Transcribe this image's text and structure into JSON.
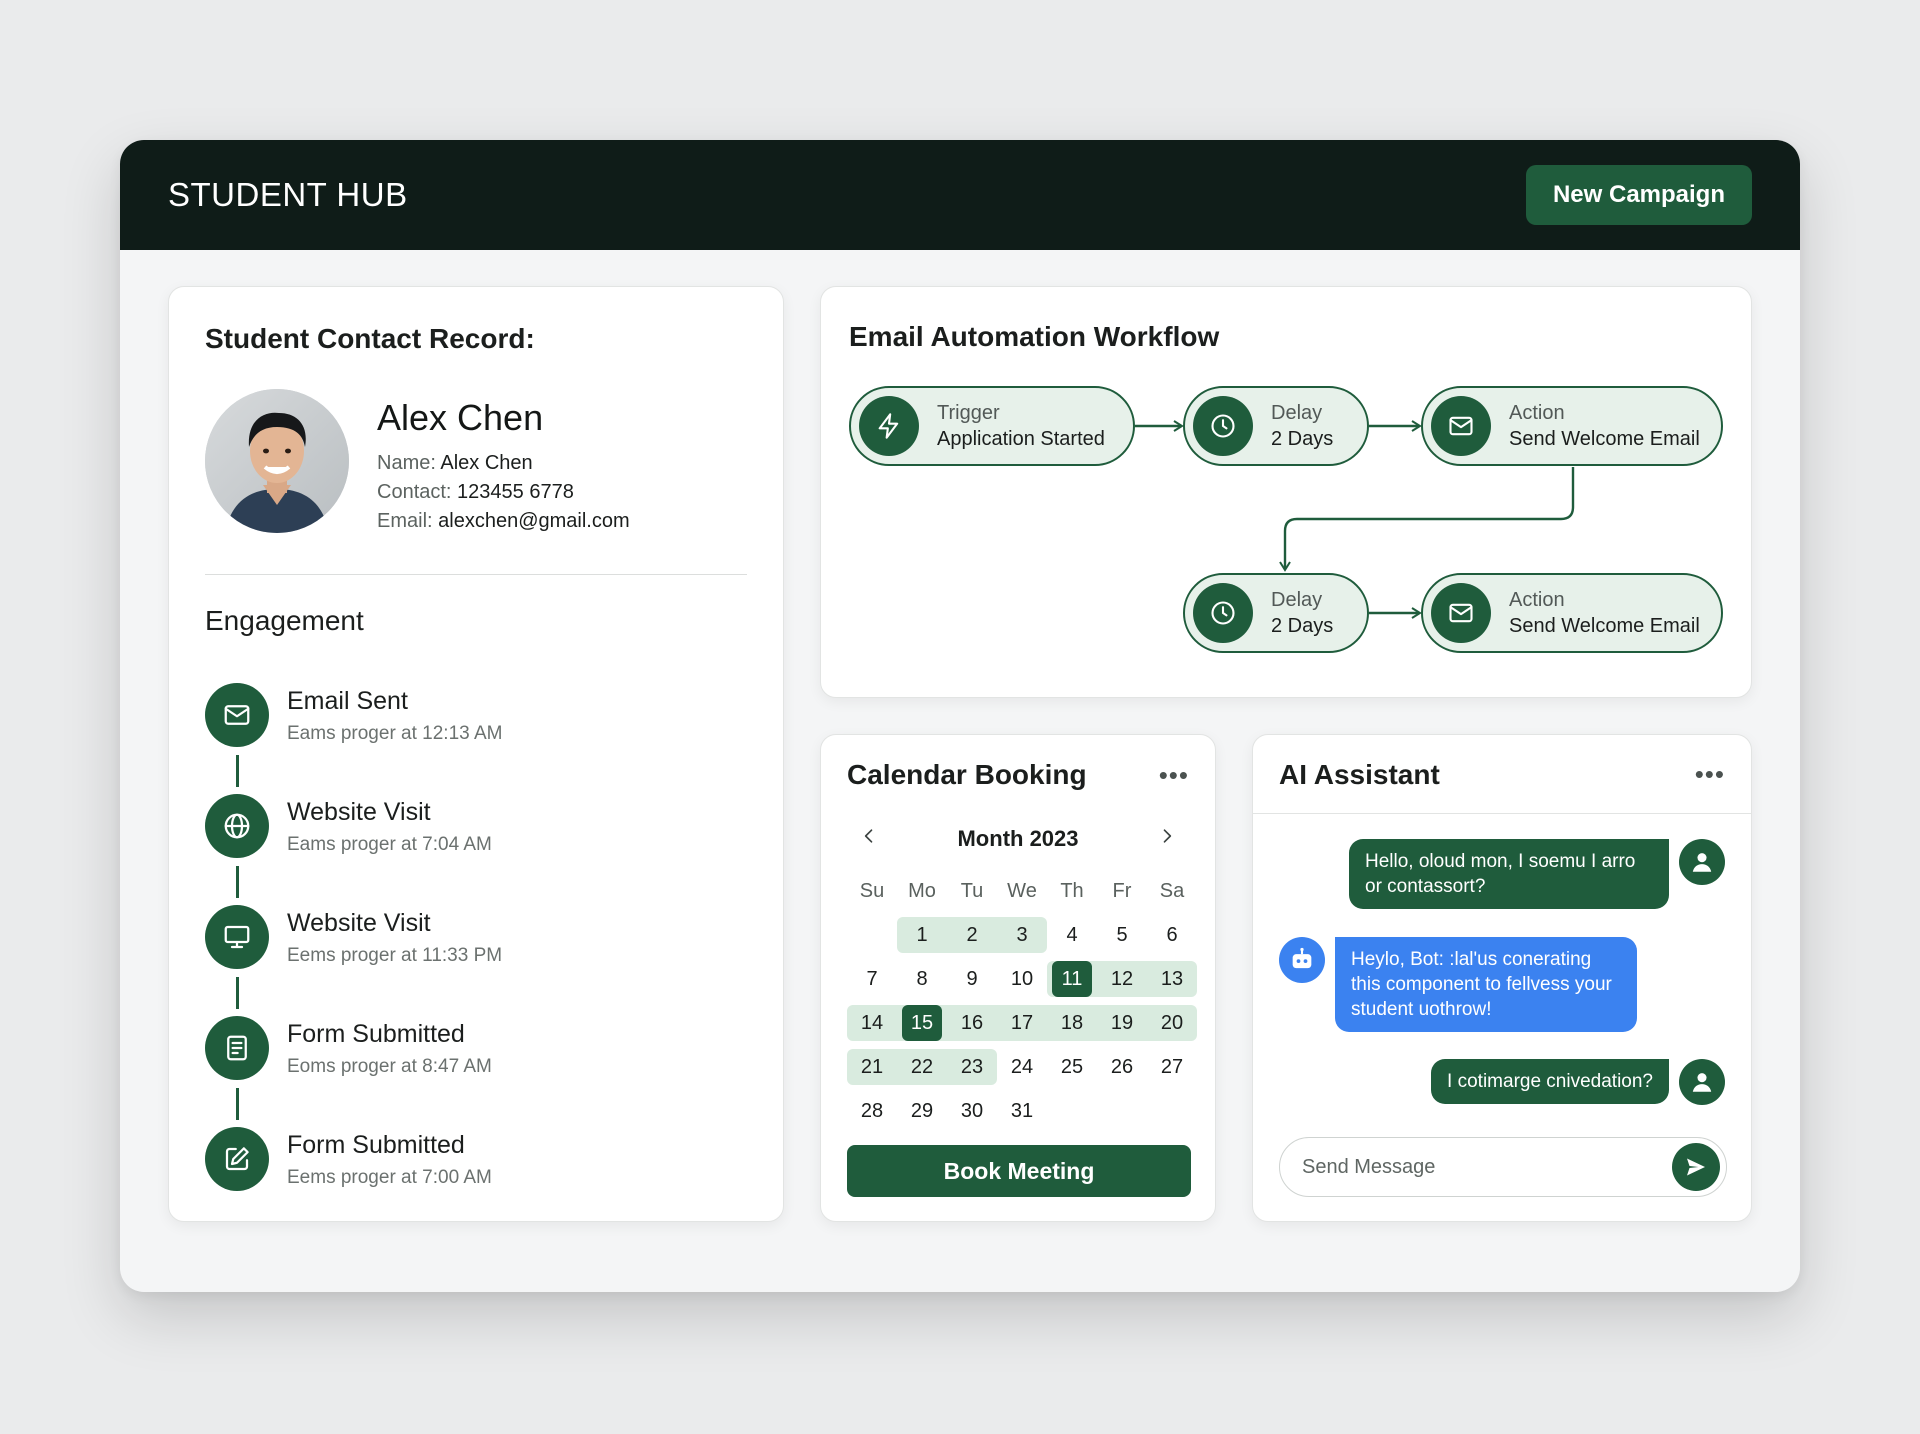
{
  "app": {
    "brand": "STUDENT HUB",
    "new_campaign_label": "New Campaign"
  },
  "contact": {
    "title": "Student Contact Record:",
    "name": "Alex Chen",
    "fields": [
      {
        "label": "Name:",
        "value": "Alex Chen"
      },
      {
        "label": "Contact:",
        "value": "123455 6778"
      },
      {
        "label": "Email:",
        "value": "alexchen@gmail.com"
      }
    ],
    "engagement_title": "Engagement",
    "engagement": [
      {
        "icon": "mail-icon",
        "title": "Email Sent",
        "sub": "Eams proger at 12:13 AM"
      },
      {
        "icon": "globe-icon",
        "title": "Website Visit",
        "sub": "Eams proger at 7:04 AM"
      },
      {
        "icon": "monitor-icon",
        "title": "Website Visit",
        "sub": "Eems proger at 11:33 PM"
      },
      {
        "icon": "document-icon",
        "title": "Form Submitted",
        "sub": "Eoms proger at 8:47 AM"
      },
      {
        "icon": "edit-icon",
        "title": "Form Submitted",
        "sub": "Eems proger at 7:00 AM"
      }
    ]
  },
  "workflow": {
    "title": "Email Automation Workflow",
    "nodes": [
      {
        "icon": "lightning-icon",
        "kind": "Trigger",
        "label": "Application Started"
      },
      {
        "icon": "clock-icon",
        "kind": "Delay",
        "label": "2 Days"
      },
      {
        "icon": "mail-icon",
        "kind": "Action",
        "label": "Send Welcome Email"
      },
      {
        "icon": "clock-icon",
        "kind": "Delay",
        "label": "2 Days"
      },
      {
        "icon": "mail-icon",
        "kind": "Action",
        "label": "Send Welcome Email"
      }
    ]
  },
  "calendar": {
    "title": "Calendar Booking",
    "more_label": "•••",
    "month_label": "Month 2023",
    "weekdays": [
      "Su",
      "Mo",
      "Tu",
      "We",
      "Th",
      "Fr",
      "Sa"
    ],
    "first_weekday_offset": 1,
    "days_in_month": 31,
    "selected_days": [
      11,
      15
    ],
    "highlighted_days": [
      1,
      2,
      3,
      12,
      13,
      14,
      16,
      17,
      18,
      19,
      20,
      21,
      22,
      23
    ],
    "book_label": "Book Meeting"
  },
  "assistant": {
    "title": "AI Assistant",
    "more_label": "•••",
    "messages": [
      {
        "from": "user",
        "text": "Hello, oloud mon, I soemu I arro or contassort?"
      },
      {
        "from": "bot",
        "text": "Heylo, Bot: :lal'us conerating this component to fellvess your student uothrow!"
      },
      {
        "from": "user",
        "text": "I cotimarge cnivedation?"
      }
    ],
    "input_placeholder": "Send Message"
  },
  "colors": {
    "brand_dark": "#0f1c18",
    "accent_green": "#1f5c3c",
    "node_fill": "#e7f1ea",
    "calendar_highlight": "#d9ebdf",
    "bot_blue": "#3b82f0"
  }
}
